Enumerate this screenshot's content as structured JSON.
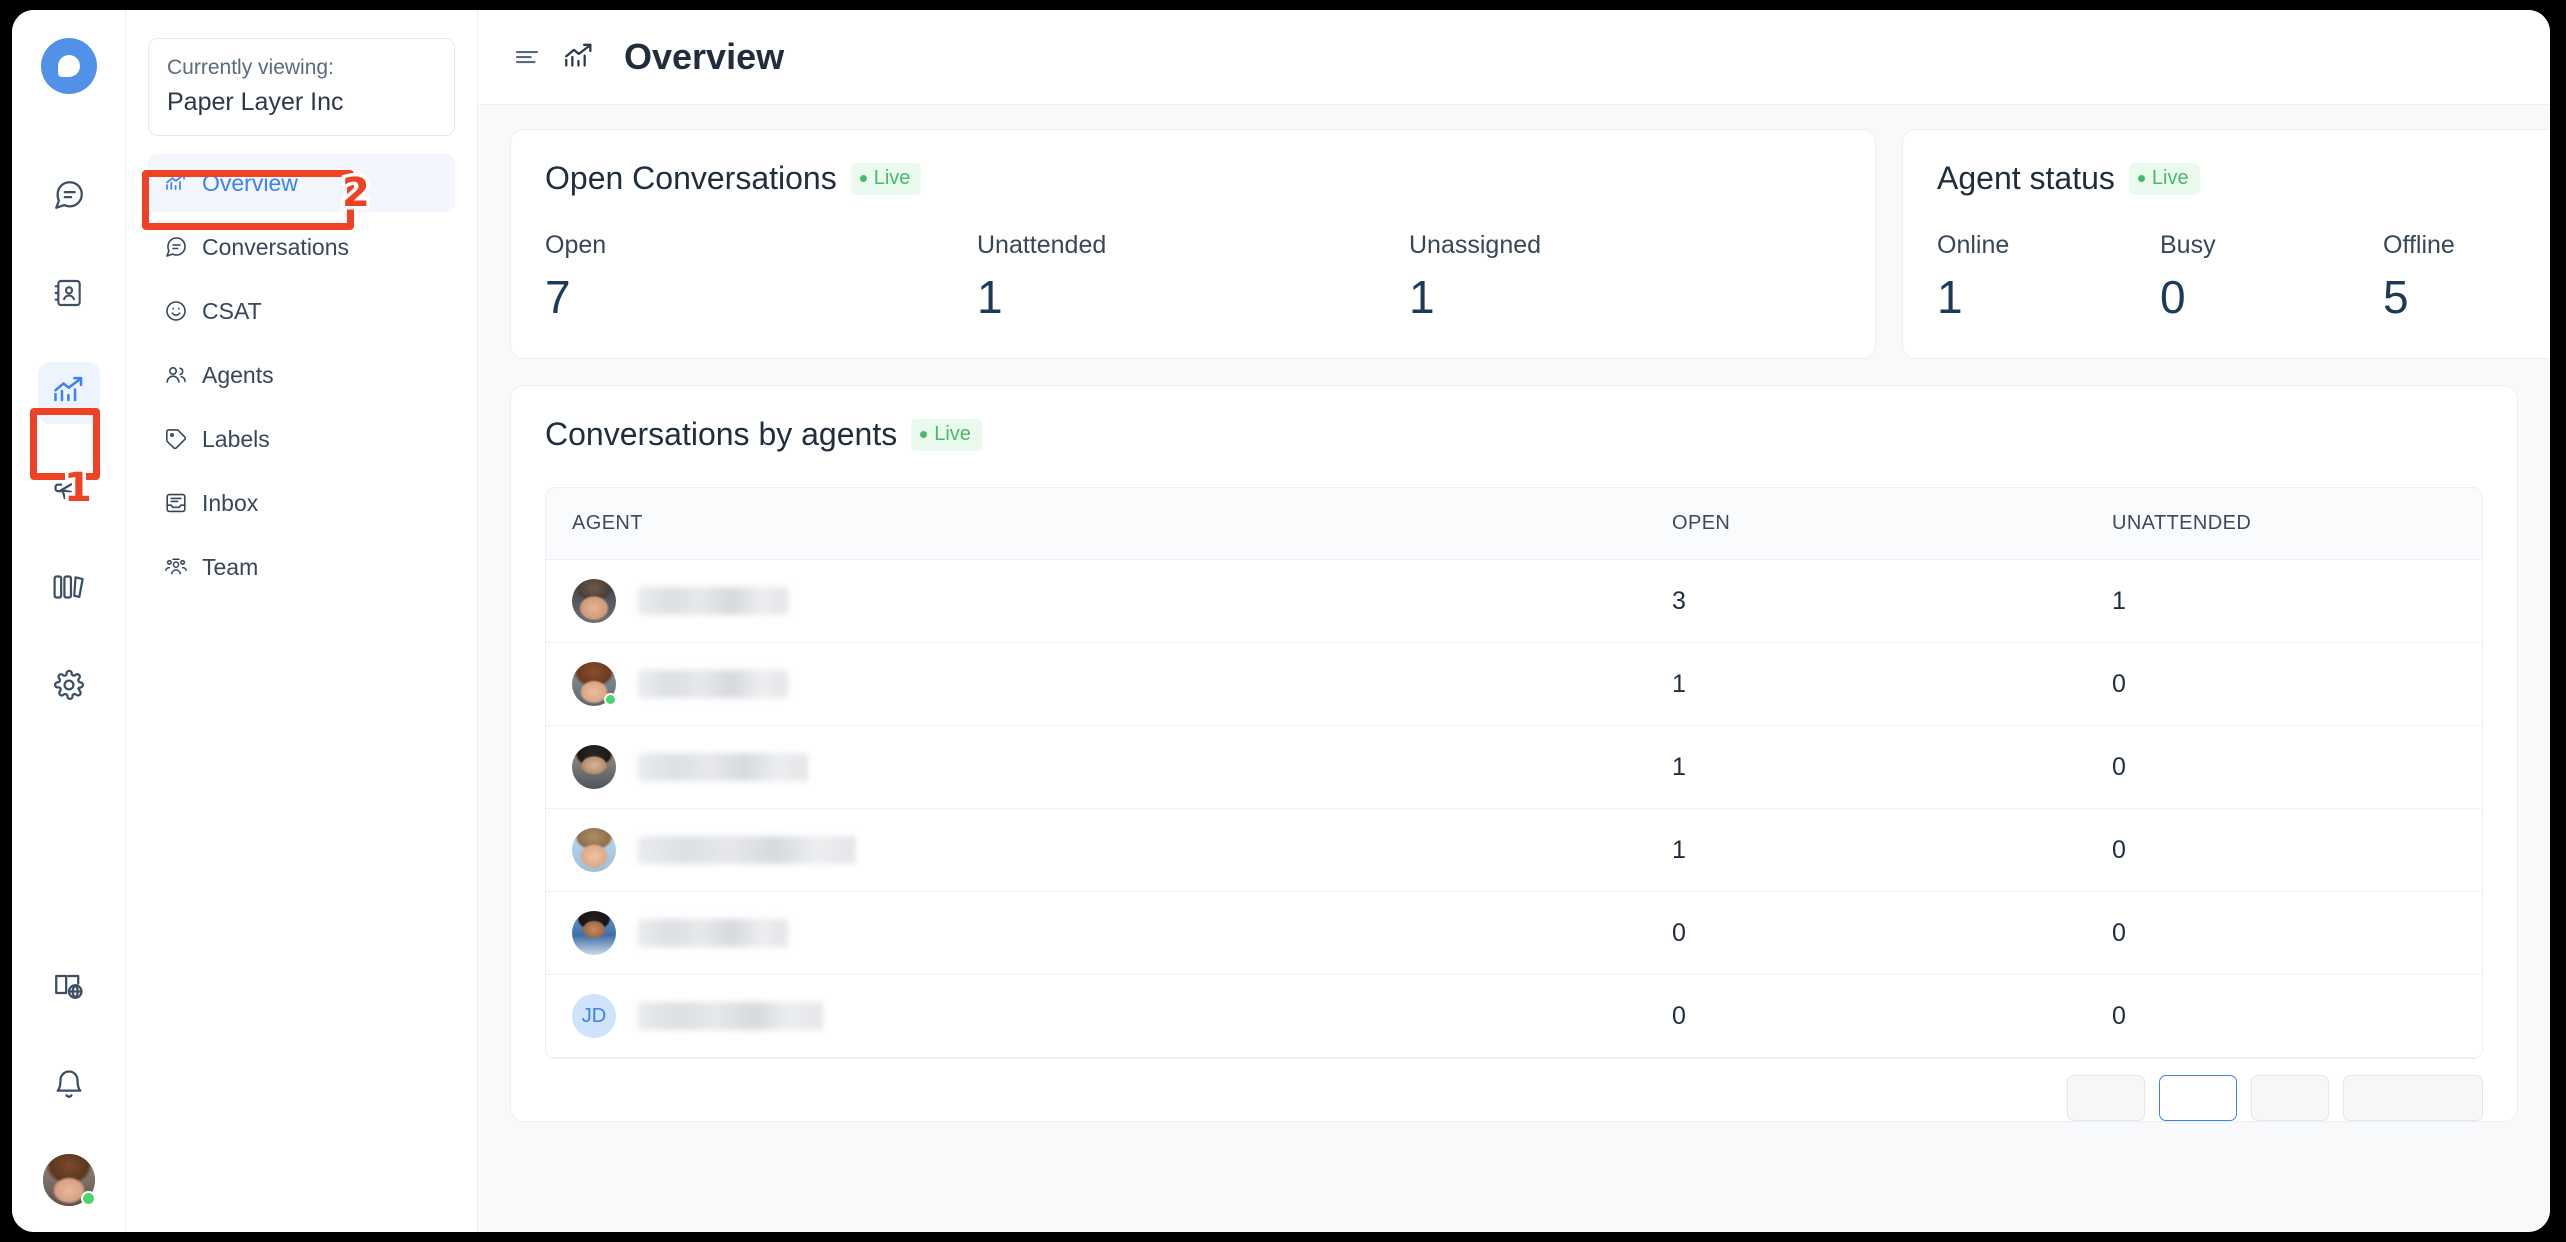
{
  "brand": {
    "logo_icon": "chatwoot-logo-icon",
    "accent_color": "#3b82f6"
  },
  "icon_rail": {
    "items": [
      {
        "name": "conversations",
        "icon": "chat-bubble-icon",
        "active": false
      },
      {
        "name": "contacts",
        "icon": "contact-book-icon",
        "active": false
      },
      {
        "name": "reports",
        "icon": "analytics-chart-icon",
        "active": true
      },
      {
        "name": "campaigns",
        "icon": "megaphone-icon",
        "active": false
      },
      {
        "name": "help-center",
        "icon": "books-icon",
        "active": false
      },
      {
        "name": "settings",
        "icon": "gear-icon",
        "active": false
      },
      {
        "name": "portal",
        "icon": "book-globe-icon",
        "active": false
      },
      {
        "name": "notifications",
        "icon": "bell-icon",
        "active": false
      }
    ],
    "avatar_status": "online"
  },
  "sidebar": {
    "org": {
      "viewing_label": "Currently viewing:",
      "name": "Paper Layer Inc"
    },
    "items": [
      {
        "label": "Overview",
        "icon": "analytics-chart-icon",
        "active": true
      },
      {
        "label": "Conversations",
        "icon": "chat-bubble-icon",
        "active": false
      },
      {
        "label": "CSAT",
        "icon": "smiley-icon",
        "active": false
      },
      {
        "label": "Agents",
        "icon": "people-icon",
        "active": false
      },
      {
        "label": "Labels",
        "icon": "tag-icon",
        "active": false
      },
      {
        "label": "Inbox",
        "icon": "inbox-icon",
        "active": false
      },
      {
        "label": "Team",
        "icon": "team-icon",
        "active": false
      }
    ]
  },
  "header": {
    "menu_icon": "hamburger-icon",
    "page_icon": "analytics-chart-icon",
    "title": "Overview"
  },
  "live_badge_label": "Live",
  "open_conversations": {
    "title": "Open Conversations",
    "metrics": [
      {
        "label": "Open",
        "value": "7"
      },
      {
        "label": "Unattended",
        "value": "1"
      },
      {
        "label": "Unassigned",
        "value": "1"
      }
    ]
  },
  "agent_status": {
    "title": "Agent status",
    "metrics": [
      {
        "label": "Online",
        "value": "1"
      },
      {
        "label": "Busy",
        "value": "0"
      },
      {
        "label": "Offline",
        "value": "5"
      }
    ]
  },
  "conversations_by_agents": {
    "title": "Conversations by agents",
    "columns": [
      "AGENT",
      "OPEN",
      "UNATTENDED"
    ],
    "rows": [
      {
        "avatar_type": "photo",
        "avatar_seed": "a1",
        "name": "",
        "online": false,
        "name_width": 150,
        "open": "3",
        "unattended": "1"
      },
      {
        "avatar_type": "photo",
        "avatar_seed": "a2",
        "name": "",
        "online": true,
        "name_width": 150,
        "open": "1",
        "unattended": "0"
      },
      {
        "avatar_type": "photo",
        "avatar_seed": "a3",
        "name": "",
        "online": false,
        "name_width": 170,
        "open": "1",
        "unattended": "0"
      },
      {
        "avatar_type": "photo",
        "avatar_seed": "a4",
        "name": "",
        "online": false,
        "name_width": 218,
        "open": "1",
        "unattended": "0"
      },
      {
        "avatar_type": "photo",
        "avatar_seed": "a5",
        "name": "",
        "online": false,
        "name_width": 150,
        "open": "0",
        "unattended": "0"
      },
      {
        "avatar_type": "initials",
        "initials": "JD",
        "name": "",
        "online": false,
        "name_width": 185,
        "open": "0",
        "unattended": "0"
      }
    ]
  },
  "annotations": [
    {
      "number": "1",
      "target": "reports-rail-button"
    },
    {
      "number": "2",
      "target": "sidebar-item-overview"
    }
  ]
}
